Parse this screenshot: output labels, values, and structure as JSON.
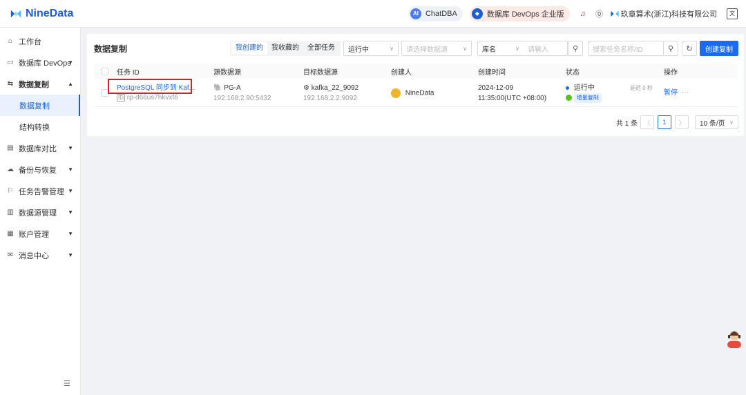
{
  "app": {
    "logo_text": "NineData"
  },
  "topbar": {
    "chatdba_label": "ChatDBA",
    "devops_label": "数据库 DevOps 企业版",
    "company": "玖章算术(浙江)科技有限公司"
  },
  "sidebar": {
    "items": [
      {
        "label": "工作台",
        "icon": "home-icon"
      },
      {
        "label": "数据库 DevOps",
        "icon": "terminal-icon"
      },
      {
        "label": "数据复制",
        "icon": "replication-icon"
      },
      {
        "label": "数据库对比",
        "icon": "compare-icon"
      },
      {
        "label": "备份与恢复",
        "icon": "backup-icon"
      },
      {
        "label": "任务告警管理",
        "icon": "alarm-icon"
      },
      {
        "label": "数据源管理",
        "icon": "datasource-icon"
      },
      {
        "label": "账户管理",
        "icon": "account-icon"
      },
      {
        "label": "消息中心",
        "icon": "mail-icon"
      }
    ],
    "subitems": [
      "数据复制",
      "结构转换"
    ]
  },
  "page": {
    "title": "数据复制",
    "tabs": [
      "我创建的",
      "我收藏的",
      "全部任务"
    ],
    "status_filter": "运行中",
    "datasource_placeholder": "请选择数据源",
    "db_filter": "库名",
    "db_input_placeholder": "请输入",
    "task_search_placeholder": "搜索任务名称/ID",
    "create_button": "创建复制"
  },
  "table": {
    "headers": [
      "任务 ID",
      "源数据源",
      "目标数据源",
      "创建人",
      "创建时间",
      "状态",
      "操作"
    ],
    "row": {
      "task_name": "PostgreSQL 同步到 Kaf...",
      "task_id": "rp-d66us7hkvxf6",
      "source_name": "PG-A",
      "source_addr": "192.168.2.90:5432",
      "target_name": "kafka_22_9092",
      "target_addr": "192.168.2.2:9092",
      "creator": "NineData",
      "created_date": "2024-12-09",
      "created_time": "11:35:00(UTC +08:00)",
      "status": "运行中",
      "delay": "延迟 0 秒",
      "phase": "增量复制",
      "action_pause": "暂停",
      "action_more": "···"
    }
  },
  "pager": {
    "total": "共 1 条",
    "current": "1",
    "size": "10 条/页"
  }
}
